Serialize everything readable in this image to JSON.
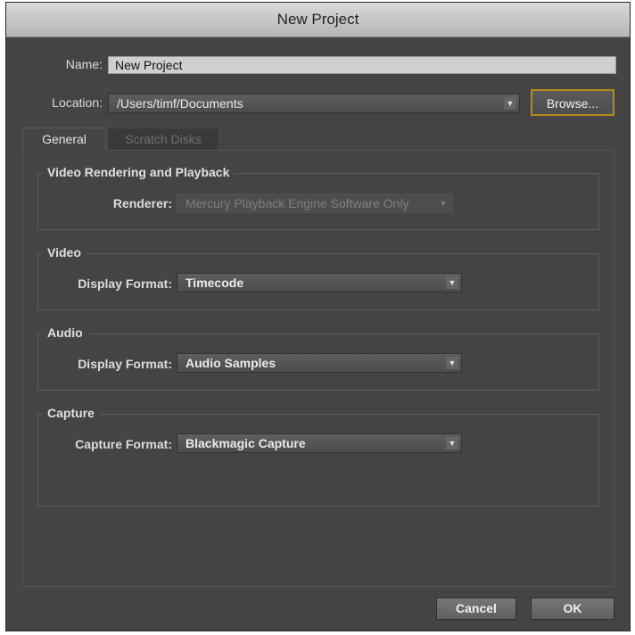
{
  "window": {
    "title": "New Project"
  },
  "name": {
    "label": "Name:",
    "value": "New Project"
  },
  "location": {
    "label": "Location:",
    "value": "/Users/timf/Documents",
    "browse_label": "Browse..."
  },
  "tabs": [
    {
      "label": "General",
      "active": true
    },
    {
      "label": "Scratch Disks",
      "active": false
    }
  ],
  "video_rendering": {
    "title": "Video Rendering and Playback",
    "renderer_label": "Renderer:",
    "renderer_value": "Mercury Playback Engine Software Only",
    "disabled": true
  },
  "video": {
    "title": "Video",
    "label": "Display Format:",
    "value": "Timecode"
  },
  "audio": {
    "title": "Audio",
    "label": "Display Format:",
    "value": "Audio Samples"
  },
  "capture": {
    "title": "Capture",
    "label": "Capture Format:",
    "value": "Blackmagic Capture"
  },
  "footer": {
    "cancel_label": "Cancel",
    "ok_label": "OK"
  },
  "icons": {
    "dropdown": "chevron-down-icon"
  },
  "colors": {
    "dialog_bg": "#444444",
    "focus_ring": "#b58b19",
    "titlebar": "#c8c8c8"
  }
}
